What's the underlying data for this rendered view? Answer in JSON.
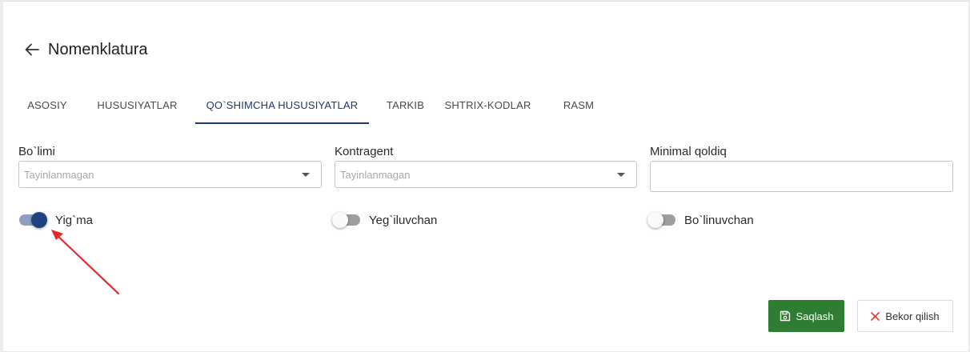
{
  "header": {
    "title": "Nomenklatura",
    "back_icon": "arrow-left-icon"
  },
  "tabs": [
    {
      "label": "ASOSIY",
      "active": false
    },
    {
      "label": "HUSUSIYATLAR",
      "active": false
    },
    {
      "label": "QO`SHIMCHA HUSUSIYATLAR",
      "active": true
    },
    {
      "label": "TARKIB",
      "active": false
    },
    {
      "label": "SHTRIX-KODLAR",
      "active": false
    },
    {
      "label": "RASM",
      "active": false
    }
  ],
  "fields": {
    "bolimi": {
      "label": "Bo`limi",
      "placeholder": "Tayinlanmagan"
    },
    "kontragent": {
      "label": "Kontragent",
      "placeholder": "Tayinlanmagan"
    },
    "minimal_qoldiq": {
      "label": "Minimal qoldiq",
      "value": ""
    }
  },
  "toggles": {
    "yigma": {
      "label": "Yig`ma",
      "checked": true
    },
    "yegiluvchan": {
      "label": "Yeg`iluvchan",
      "checked": false
    },
    "bolinuvchan": {
      "label": "Bo`linuvchan",
      "checked": false
    }
  },
  "actions": {
    "save_label": "Saqlash",
    "cancel_label": "Bekor qilish"
  },
  "colors": {
    "primary": "#1e3a6e",
    "toggle_on": "#1f4280",
    "save_button": "#2e7d32",
    "cancel_icon": "#e53935",
    "annotation_arrow": "#e8262b"
  }
}
